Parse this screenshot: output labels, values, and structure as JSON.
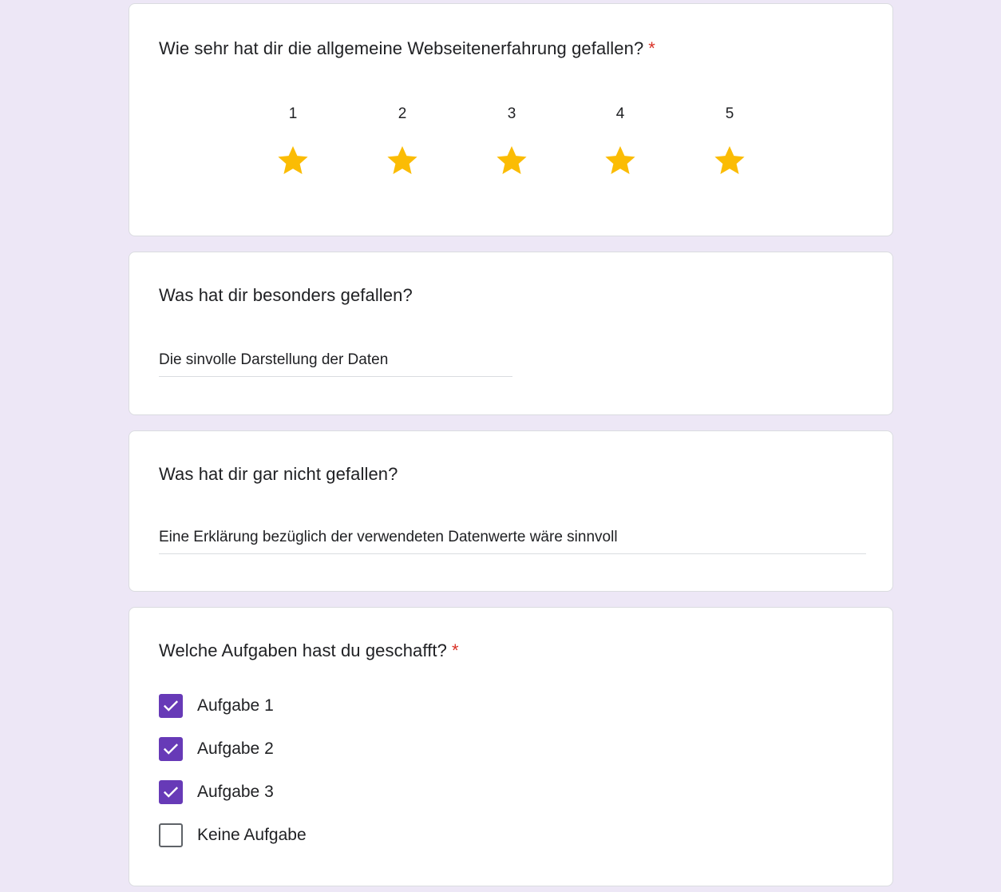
{
  "colors": {
    "page_background": "#ede7f6",
    "accent": "#673ab7",
    "required_marker": "#d93025",
    "star": "#fbbc04"
  },
  "rating_question": {
    "title": "Wie sehr hat dir die allgemeine Webseitenerfahrung gefallen?",
    "required_marker": "*",
    "scale": [
      {
        "label": "1",
        "icon": "star-icon",
        "filled": true
      },
      {
        "label": "2",
        "icon": "star-icon",
        "filled": true
      },
      {
        "label": "3",
        "icon": "star-icon",
        "filled": true
      },
      {
        "label": "4",
        "icon": "star-icon",
        "filled": true
      },
      {
        "label": "5",
        "icon": "star-icon",
        "filled": true
      }
    ],
    "selected_rating": 5
  },
  "liked_question": {
    "title": "Was hat dir besonders gefallen?",
    "answer": "Die sinvolle Darstellung der Daten"
  },
  "disliked_question": {
    "title": "Was hat dir gar nicht gefallen?",
    "answer": "Eine Erklärung bezüglich der verwendeten Datenwerte wäre sinnvoll"
  },
  "tasks_question": {
    "title": "Welche Aufgaben hast du geschafft?",
    "required_marker": "*",
    "options": [
      {
        "label": "Aufgabe 1",
        "checked": true,
        "icon": "check-icon"
      },
      {
        "label": "Aufgabe 2",
        "checked": true,
        "icon": "check-icon"
      },
      {
        "label": "Aufgabe 3",
        "checked": true,
        "icon": "check-icon"
      },
      {
        "label": "Keine Aufgabe",
        "checked": false,
        "icon": "empty-checkbox"
      }
    ]
  }
}
